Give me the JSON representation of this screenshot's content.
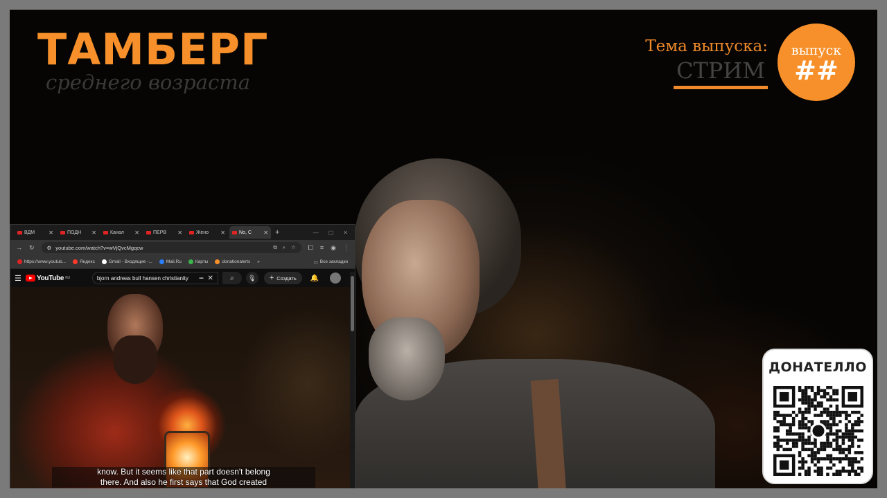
{
  "stream": {
    "brand_title": "ТАМБЕРГ",
    "brand_subtitle": "среднего возраста",
    "topic_label": "Тема выпуска:",
    "topic_value": "СТРИМ",
    "episode_word": "выпуск",
    "episode_number": "##",
    "donate_title": "ДОНАТЕЛЛО",
    "colors": {
      "accent": "#f7902a",
      "background": "#060504",
      "frame": "#7a7a7a"
    }
  },
  "browser": {
    "tabs": [
      {
        "label": "ВДМ"
      },
      {
        "label": "ПОДН"
      },
      {
        "label": "Канал"
      },
      {
        "label": "ПЕРВ"
      },
      {
        "label": "Жено"
      },
      {
        "label": "No, C",
        "active": true
      }
    ],
    "new_tab": "+",
    "url": "youtube.com/watch?v=wVjQvcMgqcw",
    "bookmarks": [
      {
        "label": "https://www.youtub...",
        "color": "#e02424"
      },
      {
        "label": "Яндекс",
        "color": "#ff3a2a"
      },
      {
        "label": "Gmail - Входящие -...",
        "color": "#ffffff"
      },
      {
        "label": "Mail.Ru",
        "color": "#2a7fff"
      },
      {
        "label": "Карты",
        "color": "#3cb44b"
      },
      {
        "label": "donationalerts",
        "color": "#f7902a"
      }
    ],
    "bookmarks_more": "»",
    "all_bookmarks": "Все закладки"
  },
  "youtube": {
    "logo": "YouTube",
    "region": "RU",
    "search_query": "bjorn andreas bull hansen christianity",
    "create_label": "Создать",
    "captions": [
      "know. But it seems like that part doesn't belong",
      "there. And also he first says that God created"
    ]
  }
}
